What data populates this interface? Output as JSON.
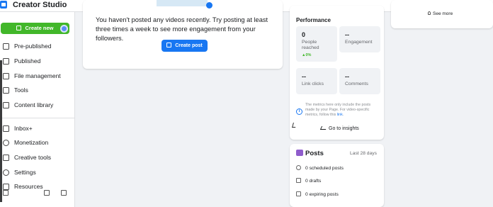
{
  "header": {
    "app_title": "Creator Studio",
    "tabs": [
      {
        "icon": "facebook-icon",
        "active": true,
        "glyph": "f"
      },
      {
        "icon": "instagram-icon",
        "active": false
      }
    ],
    "help_glyph": "?",
    "caret_glyph": "▾"
  },
  "sidebar": {
    "create_label": "Create new",
    "items": [
      {
        "label": "Pre-published",
        "icon": "pre-published-icon"
      },
      {
        "label": "Published",
        "icon": "published-icon"
      },
      {
        "label": "File management",
        "icon": "file-management-icon"
      },
      {
        "label": "Tools",
        "icon": "tools-icon"
      },
      {
        "label": "Content library",
        "icon": "content-library-icon"
      },
      {
        "label": "Inbox+",
        "icon": "inbox-icon"
      },
      {
        "label": "Monetization",
        "icon": "monetization-icon"
      },
      {
        "label": "Creative tools",
        "icon": "creative-tools-icon"
      },
      {
        "label": "Settings",
        "icon": "settings-icon"
      },
      {
        "label": "Resources",
        "icon": "resources-icon"
      }
    ]
  },
  "main": {
    "empty_message": "You haven't posted any videos recently. Try posting at least three times a week to see more engagement from your followers.",
    "create_post_label": "Create post"
  },
  "performance": {
    "title": "Performance",
    "metrics": [
      {
        "value": "0",
        "label": "People reached",
        "change": "▲0%"
      },
      {
        "value": "--",
        "label": "Engagement",
        "change": ""
      },
      {
        "value": "--",
        "label": "Link clicks",
        "change": ""
      },
      {
        "value": "--",
        "label": "Comments",
        "change": ""
      }
    ],
    "info_glyph": "i",
    "note_text": "The metrics here only include the posts made by your Page. For video-specific metrics, follow this",
    "note_link": "link",
    "note_end": ".",
    "insights_label": "Go to insights"
  },
  "posts": {
    "title": "Posts",
    "range": "Last 28 days",
    "rows": [
      {
        "label": "0 scheduled posts",
        "icon": "clock-icon"
      },
      {
        "label": "0 drafts",
        "icon": "draft-icon"
      },
      {
        "label": "0 expiring posts",
        "icon": "expiring-icon"
      }
    ]
  },
  "right_panel": {
    "see_more_label": "See more"
  },
  "colors": {
    "brand_blue": "#1877f2",
    "create_green": "#42b72a",
    "posts_purple": "#8f5ccc"
  }
}
